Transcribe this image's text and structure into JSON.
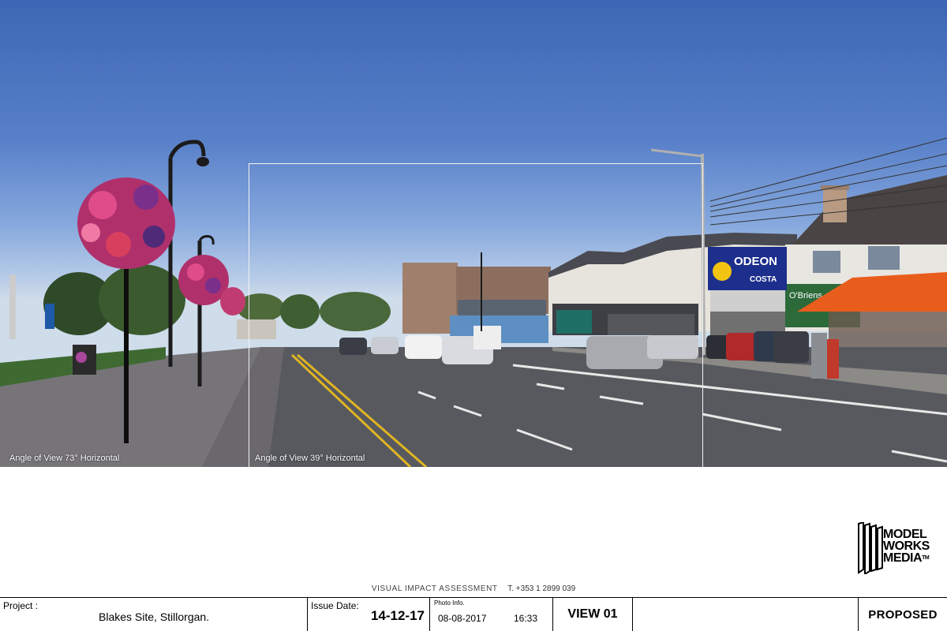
{
  "photo": {
    "angle_of_view_wide": "Angle of View 73° Horizontal",
    "angle_of_view_narrow": "Angle of View 39° Horizontal",
    "signage": {
      "odeon": "ODEON",
      "costa": "COSTA",
      "obriens": "O'Briens"
    }
  },
  "logo": {
    "line1": "MODEL",
    "line2": "WORKS",
    "line3": "MEDIA",
    "tm": "TM"
  },
  "contact": {
    "assessment": "VISUAL IMPACT ASSESSMENT",
    "phone": "T. +353 1 2899 039"
  },
  "titleblock": {
    "project_label": "Project :",
    "project_name": "Blakes Site, Stillorgan.",
    "issue_label": "Issue Date:",
    "issue_date": "14-12-17",
    "photo_label": "Photo Info.",
    "photo_date": "08-08-2017",
    "photo_time": "16:33",
    "view": "VIEW 01",
    "status": "PROPOSED"
  }
}
